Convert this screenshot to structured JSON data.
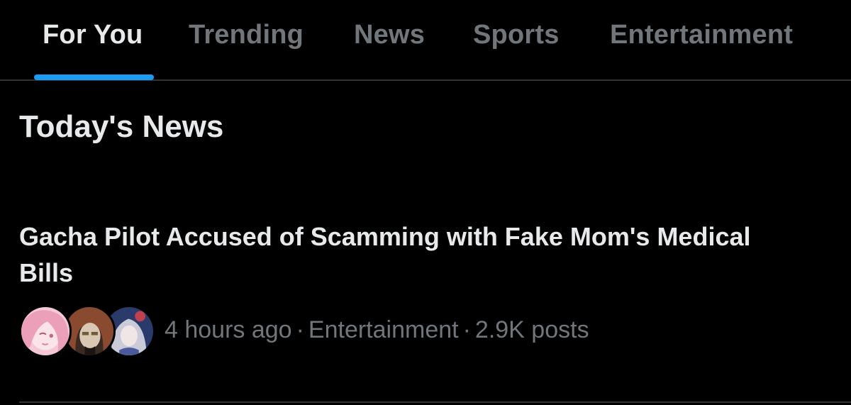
{
  "tabs": [
    {
      "label": "For You",
      "active": true
    },
    {
      "label": "Trending",
      "active": false
    },
    {
      "label": "News",
      "active": false
    },
    {
      "label": "Sports",
      "active": false
    },
    {
      "label": "Entertainment",
      "active": false
    }
  ],
  "colors": {
    "accent": "#1d9bf0",
    "background": "#000000",
    "text_primary": "#e7e9ea",
    "text_secondary": "#71767b",
    "divider": "#2f3336"
  },
  "section": {
    "title": "Today's News"
  },
  "news_item": {
    "headline": "Gacha Pilot Accused of Scamming with Fake Mom's Medical Bills",
    "avatars": [
      "avatar-pink-anime-character",
      "avatar-dark-hair-character",
      "avatar-silver-hair-character"
    ],
    "meta": {
      "time": "4 hours ago",
      "separator": "·",
      "category": "Entertainment",
      "posts": "2.9K posts"
    }
  }
}
